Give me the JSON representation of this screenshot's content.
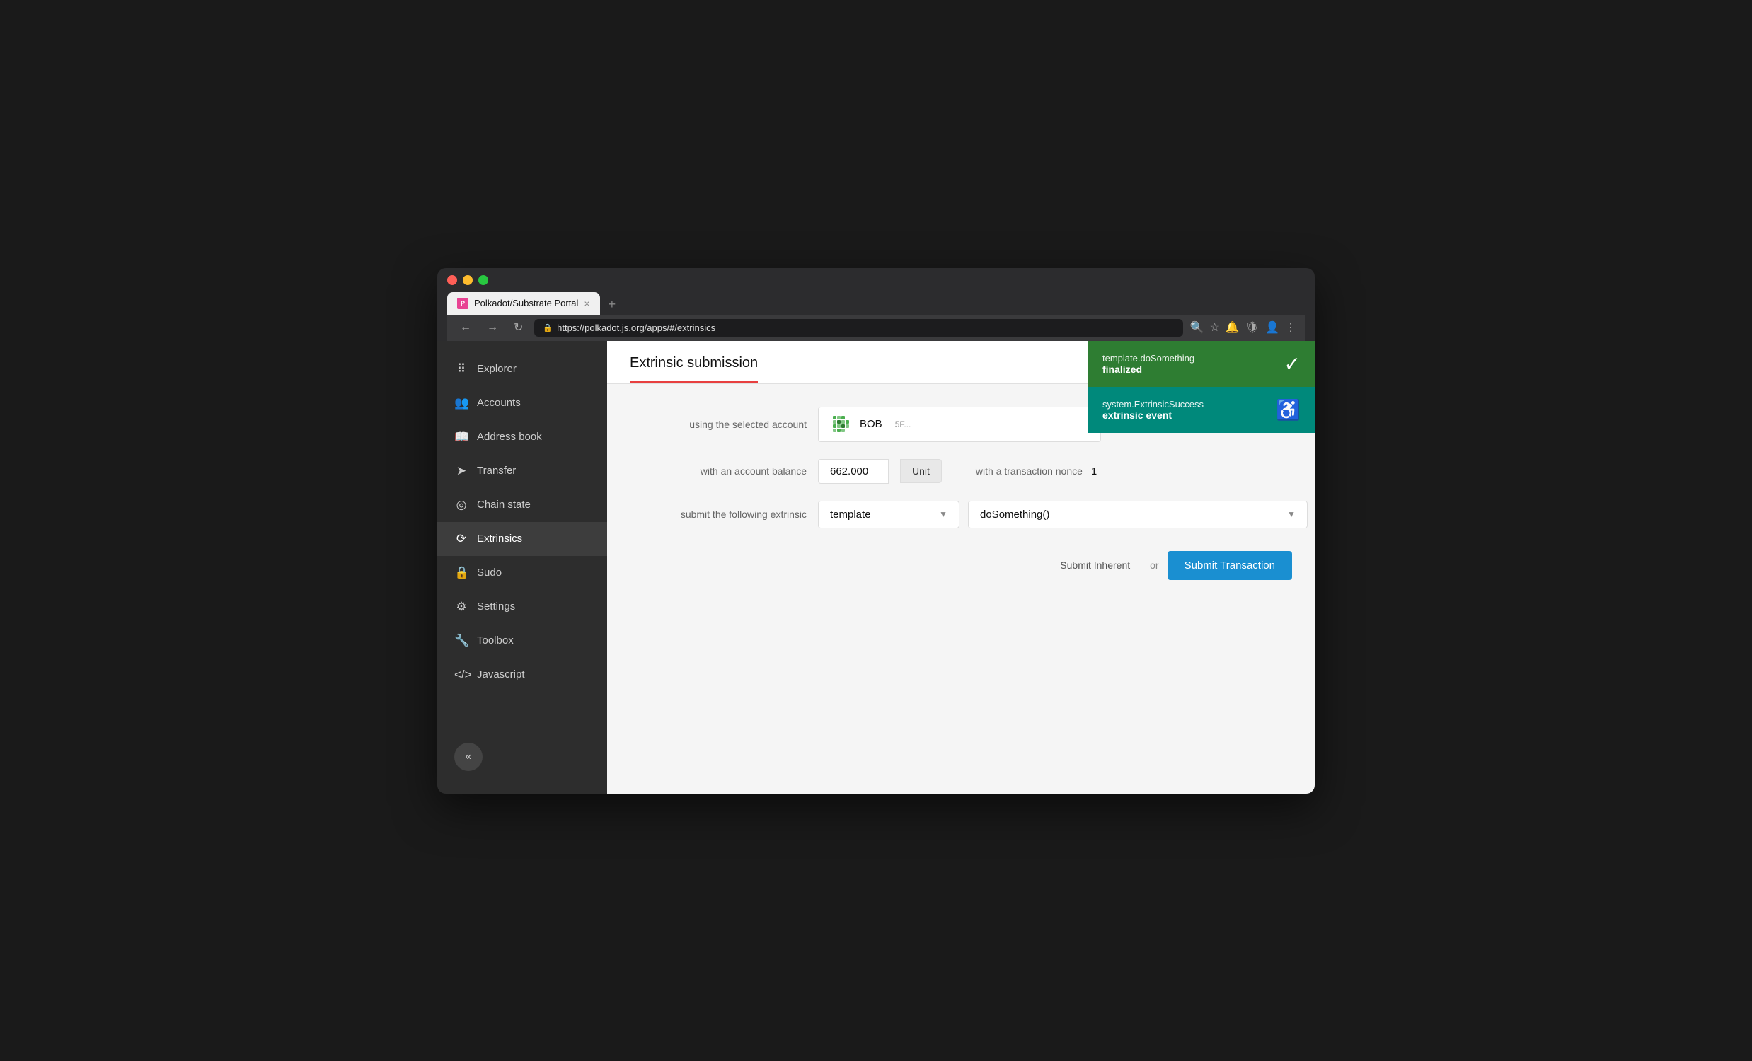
{
  "browser": {
    "tab_title": "Polkadot/Substrate Portal",
    "tab_close": "×",
    "tab_new": "+",
    "address": "https://polkadot.js.org/apps/#/extrinsics",
    "back_btn": "←",
    "forward_btn": "→",
    "refresh_btn": "↻"
  },
  "sidebar": {
    "items": [
      {
        "id": "explorer",
        "label": "Explorer",
        "icon": "⠿"
      },
      {
        "id": "accounts",
        "label": "Accounts",
        "icon": "👥"
      },
      {
        "id": "address-book",
        "label": "Address book",
        "icon": "📖"
      },
      {
        "id": "transfer",
        "label": "Transfer",
        "icon": "➤"
      },
      {
        "id": "chain-state",
        "label": "Chain state",
        "icon": "◎"
      },
      {
        "id": "extrinsics",
        "label": "Extrinsics",
        "icon": "⟳"
      },
      {
        "id": "sudo",
        "label": "Sudo",
        "icon": "🔒"
      },
      {
        "id": "settings",
        "label": "Settings",
        "icon": "⚙"
      },
      {
        "id": "toolbox",
        "label": "Toolbox",
        "icon": "🔧"
      },
      {
        "id": "javascript",
        "label": "Javascript",
        "icon": "</>"
      }
    ],
    "active": "extrinsics",
    "collapse_label": "«"
  },
  "page": {
    "title": "Extrinsic submission"
  },
  "form": {
    "account_label": "using the selected account",
    "account_name": "BOB",
    "account_address": "5F...",
    "balance_label": "with an account balance",
    "balance_value": "662.000",
    "unit_label": "Unit",
    "nonce_label": "with a transaction nonce",
    "nonce_value": "1",
    "extrinsic_label": "submit the following extrinsic",
    "module_value": "template",
    "method_value": "doSomething()",
    "method_detail": "doSomething",
    "submit_inherent_label": "Submit Inherent",
    "or_label": "or",
    "submit_transaction_label": "Submit Transaction"
  },
  "notifications": [
    {
      "id": "finalized",
      "title": "template.doSomething",
      "subtitle": "finalized",
      "icon": "✓",
      "color": "#2e7d32"
    },
    {
      "id": "event",
      "title": "system.ExtrinsicSuccess",
      "subtitle": "extrinsic event",
      "icon": "♿",
      "color": "#00897b"
    }
  ]
}
